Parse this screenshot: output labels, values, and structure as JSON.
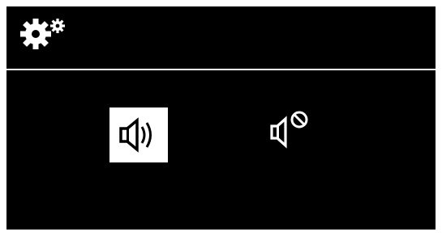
{
  "screen": {
    "background": "#000000",
    "foreground": "#ffffff"
  },
  "header": {
    "icon": "settings-gears-icon"
  },
  "sound_options": [
    {
      "icon": "speaker-on-icon",
      "selected": true
    },
    {
      "icon": "speaker-muted-icon",
      "selected": false
    }
  ]
}
